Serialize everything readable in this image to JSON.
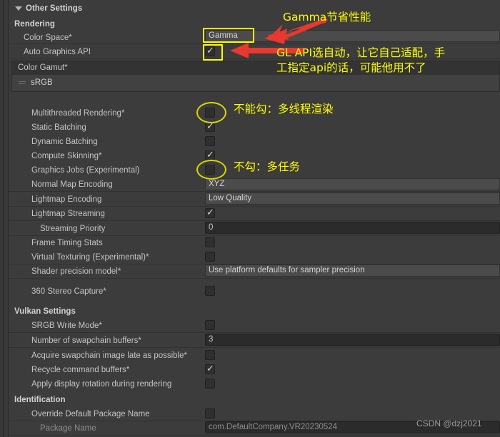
{
  "panel": {
    "foldout": {
      "label": "Other Settings",
      "expanded": true
    },
    "sections": {
      "rendering": "Rendering",
      "vulkan": "Vulkan Settings",
      "identification": "Identification"
    },
    "color_space": {
      "label": "Color Space*",
      "value": "Gamma"
    },
    "auto_graphics_api": {
      "label": "Auto Graphics API",
      "checked": true
    },
    "color_gamut": {
      "label": "Color Gamut*",
      "items": [
        "sRGB"
      ]
    },
    "rows": [
      {
        "label": "Multithreaded Rendering*",
        "type": "checkbox",
        "value": false
      },
      {
        "label": "Static Batching",
        "type": "checkbox",
        "value": true
      },
      {
        "label": "Dynamic Batching",
        "type": "checkbox",
        "value": false
      },
      {
        "label": "Compute Skinning*",
        "type": "checkbox",
        "value": true
      },
      {
        "label": "Graphics Jobs (Experimental)",
        "type": "checkbox",
        "value": false
      },
      {
        "label": "Normal Map Encoding",
        "type": "popup",
        "value": "XYZ"
      },
      {
        "label": "Lightmap Encoding",
        "type": "popup",
        "value": "Low Quality"
      },
      {
        "label": "Lightmap Streaming",
        "type": "checkbox",
        "value": true
      },
      {
        "label": "Streaming Priority",
        "type": "input",
        "value": "0"
      },
      {
        "label": "Frame Timing Stats",
        "type": "checkbox",
        "value": false
      },
      {
        "label": "Virtual Texturing (Experimental)*",
        "type": "checkbox",
        "value": false
      },
      {
        "label": "Shader precision model*",
        "type": "popup",
        "value": "Use platform defaults for sampler precision"
      },
      {
        "label": "360 Stereo Capture*",
        "type": "checkbox",
        "value": false
      }
    ],
    "vulkan_rows": [
      {
        "label": "SRGB Write Mode*",
        "type": "checkbox",
        "value": false
      },
      {
        "label": "Number of swapchain buffers*",
        "type": "input",
        "value": "3"
      },
      {
        "label": "Acquire swapchain image late as possible*",
        "type": "checkbox",
        "value": false
      },
      {
        "label": "Recycle command buffers*",
        "type": "checkbox",
        "value": true
      },
      {
        "label": "Apply display rotation during rendering",
        "type": "checkbox",
        "value": false
      }
    ],
    "identification_rows": [
      {
        "label": "Override Default Package Name",
        "type": "checkbox",
        "value": false
      },
      {
        "label": "Package Name",
        "type": "input",
        "value": "com.DefaultCompany.VR20230524"
      }
    ]
  },
  "annotations": {
    "gamma_note": "Gamma节省性能",
    "gl_api_note_line1": "GL API选自动，让它自己适配，手",
    "gl_api_note_line2": "工指定api的话，可能他用不了",
    "multithread_note": "不能勾：多线程渲染",
    "graphics_jobs_note": "不勾：多任务",
    "highlight_color": "#ffff00",
    "arrow_color": "#e8382f"
  },
  "watermark": {
    "text": "CSDN @dzj2021"
  }
}
